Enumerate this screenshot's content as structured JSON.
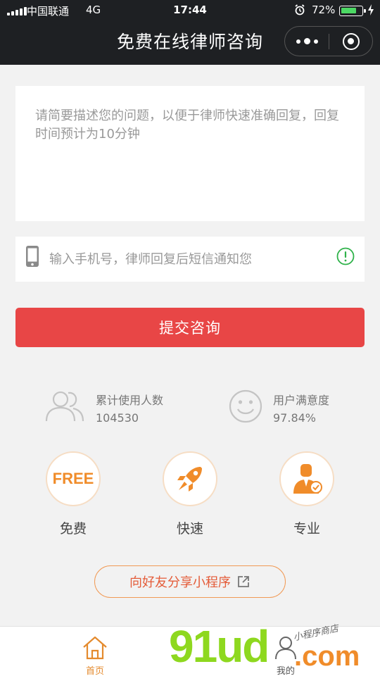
{
  "status_bar": {
    "carrier": "中国联通",
    "network": "4G",
    "time": "17:44",
    "battery": "72%",
    "battery_level": 0.72,
    "battery_color": "#4cd964"
  },
  "nav": {
    "title": "免费在线律师咨询",
    "more_icon": "more-dots-icon",
    "close_icon": "target-circle-icon"
  },
  "form": {
    "question_placeholder": "请简要描述您的问题，以便于律师快速准确回复，回复时间预计为10分钟",
    "question_value": "",
    "phone_placeholder": "输入手机号，律师回复后短信通知您",
    "phone_value": "",
    "submit_label": "提交咨询",
    "submit_color": "#e84646"
  },
  "stats": [
    {
      "icon": "users-icon",
      "label": "累计使用人数",
      "value": "104530"
    },
    {
      "icon": "smiley-icon",
      "label": "用户满意度",
      "value": "97.84%"
    }
  ],
  "features": [
    {
      "icon": "free-badge-icon",
      "badge": "FREE",
      "label": "免费"
    },
    {
      "icon": "rocket-icon",
      "label": "快速"
    },
    {
      "icon": "lawyer-badge-icon",
      "label": "专业"
    }
  ],
  "share_button": {
    "label": "向好友分享小程序",
    "icon": "external-link-icon"
  },
  "tabbar": [
    {
      "icon": "home-icon",
      "label": "首页",
      "active": true
    },
    {
      "icon": "person-icon",
      "label": "我的",
      "active": false
    }
  ],
  "watermark": {
    "main": "91ud",
    "domain": ".com",
    "tagline": "小程序商店"
  },
  "colors": {
    "accent_orange": "#f08c2a",
    "nav_bg": "#1e2023",
    "page_bg": "#f2f2f2"
  }
}
